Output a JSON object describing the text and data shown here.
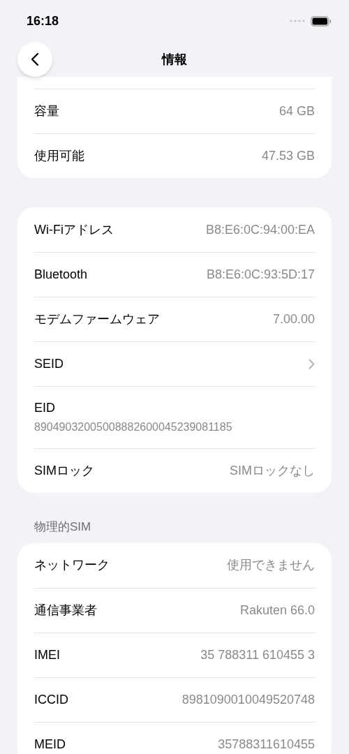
{
  "status_bar": {
    "time": "16:18"
  },
  "nav": {
    "title": "情報"
  },
  "sections": [
    {
      "rows": [
        {
          "kind": "value",
          "label": "容量",
          "value": "64 GB"
        },
        {
          "kind": "value",
          "label": "使用可能",
          "value": "47.53 GB"
        }
      ]
    },
    {
      "rows": [
        {
          "kind": "value",
          "label": "Wi-Fiアドレス",
          "value": "B8:E6:0C:94:00:EA"
        },
        {
          "kind": "value",
          "label": "Bluetooth",
          "value": "B8:E6:0C:93:5D:17"
        },
        {
          "kind": "value",
          "label": "モデムファームウェア",
          "value": "7.00.00"
        },
        {
          "kind": "chevron",
          "label": "SEID"
        },
        {
          "kind": "stacked",
          "label": "EID",
          "value": "89049032005008882600045239081185"
        },
        {
          "kind": "value",
          "label": "SIMロック",
          "value": "SIMロックなし"
        }
      ]
    },
    {
      "header": "物理的SIM",
      "rows": [
        {
          "kind": "value",
          "label": "ネットワーク",
          "value": "使用できません"
        },
        {
          "kind": "value",
          "label": "通信事業者",
          "value": "Rakuten 66.0"
        },
        {
          "kind": "value",
          "label": "IMEI",
          "value": "35 788311 610455 3"
        },
        {
          "kind": "value",
          "label": "ICCID",
          "value": "8981090010049520748"
        },
        {
          "kind": "value",
          "label": "MEID",
          "value": "35788311610455"
        }
      ]
    }
  ]
}
